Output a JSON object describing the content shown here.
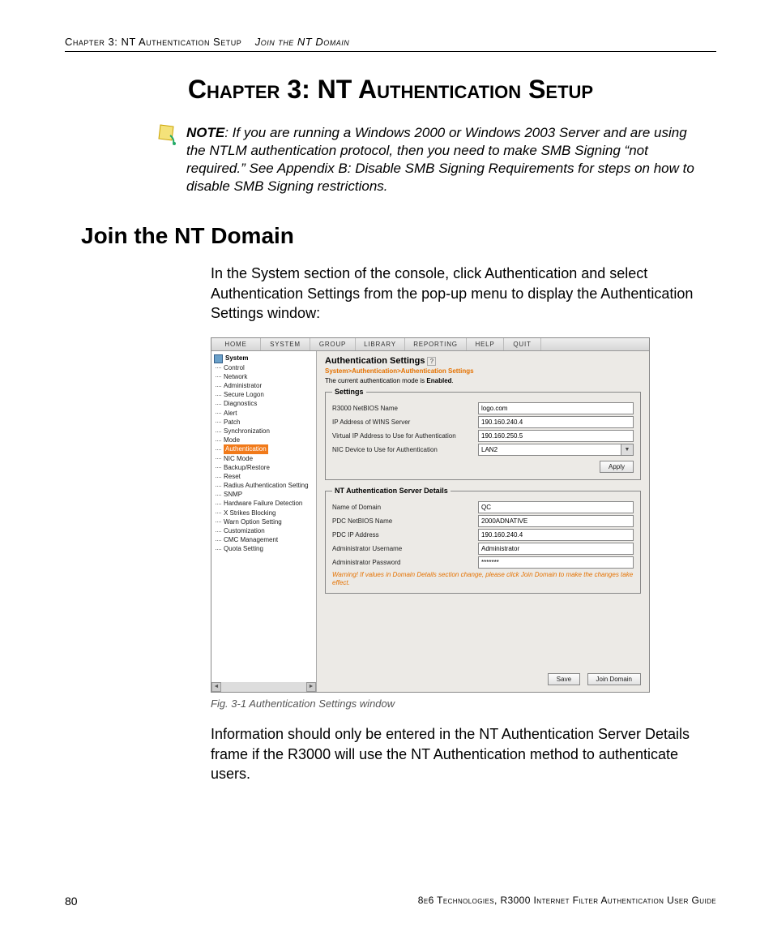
{
  "runningHead": {
    "chapter": "Chapter 3: NT Authentication Setup",
    "section": "Join the NT Domain"
  },
  "chapterTitle": "Chapter 3: NT Authentication Setup",
  "note": {
    "label": "NOTE",
    "text": ": If you are running a Windows 2000 or Windows 2003 Server and are using the NTLM authentication protocol, then you need to make SMB Signing “not required.” See Appendix B: Disable SMB Signing Requirements for steps on how to disable SMB Signing restrictions."
  },
  "sectionTitle": "Join the NT Domain",
  "para1": "In the System section of the console, click Authentication and select Authentication Settings from the pop-up menu to display the Authentication Settings window:",
  "figCaption": "Fig. 3-1  Authentication Settings window",
  "para2": "Information should only be entered in the NT Authentication Server Details frame if the R3000 will use the NT Authentication method to authenticate users.",
  "footer": {
    "page": "80",
    "guide": "8e6 Technologies, R3000 Internet Filter Authentication User Guide"
  },
  "menu": [
    "HOME",
    "SYSTEM",
    "GROUP",
    "LIBRARY",
    "REPORTING",
    "HELP",
    "QUIT"
  ],
  "tree": {
    "root": "System",
    "items": [
      "Control",
      "Network",
      "Administrator",
      "Secure Logon",
      "Diagnostics",
      "Alert",
      "Patch",
      "Synchronization",
      "Mode",
      "Authentication",
      "NIC Mode",
      "Backup/Restore",
      "Reset",
      "Radius Authentication Setting",
      "SNMP",
      "Hardware Failure Detection",
      "X Strikes Blocking",
      "Warn Option Setting",
      "Customization",
      "CMC Management",
      "Quota Setting"
    ],
    "selected": "Authentication"
  },
  "panel": {
    "title": "Authentication Settings",
    "crumb": "System>Authentication>Authentication Settings",
    "modeLine": "The current authentication mode is Enabled.",
    "settingsLegend": "Settings",
    "ntLegend": "NT Authentication Server Details",
    "rows": {
      "netbios": {
        "label": "R3000 NetBIOS Name",
        "value": "logo.com"
      },
      "wins": {
        "label": "IP Address of WINS Server",
        "value": "190.160.240.4"
      },
      "vip": {
        "label": "Virtual IP Address to Use for Authentication",
        "value": "190.160.250.5"
      },
      "nic": {
        "label": "NIC Device to Use for Authentication",
        "value": "LAN2"
      },
      "domain": {
        "label": "Name of Domain",
        "value": "QC"
      },
      "pdcNetbios": {
        "label": "PDC NetBIOS Name",
        "value": "2000ADNATIVE"
      },
      "pdcIp": {
        "label": "PDC IP Address",
        "value": "190.160.240.4"
      },
      "adminUser": {
        "label": "Administrator Username",
        "value": "Administrator"
      },
      "adminPass": {
        "label": "Administrator Password",
        "value": "*******"
      }
    },
    "warn": "Warning! If values in Domain Details section change, please click Join Domain to make the changes take effect.",
    "buttons": {
      "apply": "Apply",
      "save": "Save",
      "join": "Join Domain"
    }
  }
}
